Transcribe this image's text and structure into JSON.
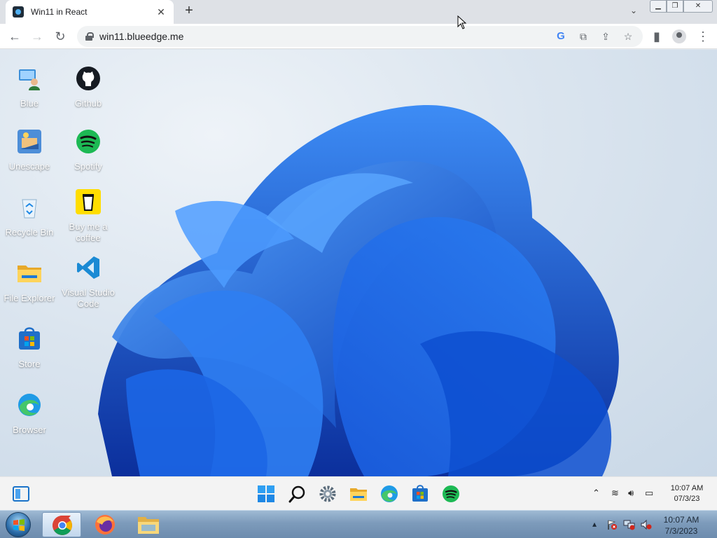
{
  "browser": {
    "tab_title": "Win11 in React",
    "tab_close": "✕",
    "new_tab": "+",
    "tab_search": "⌄",
    "window_controls": {
      "minimize": "▁",
      "maximize": "❐",
      "close": "✕"
    },
    "url": "win11.blueedge.me",
    "back": "←",
    "forward": "→",
    "reload": "↻",
    "google_icon": "G",
    "open_icon": "⧉",
    "share_icon": "⇪",
    "star_icon": "☆",
    "sidepanel_icon": "▮",
    "menu_icon": "⋮"
  },
  "desktop": {
    "icons": [
      {
        "label": "Blue"
      },
      {
        "label": "Github"
      },
      {
        "label": "Unescape"
      },
      {
        "label": "Spotify"
      },
      {
        "label": "Recycle Bin"
      },
      {
        "label": "Buy me a coffee"
      },
      {
        "label": "File Explorer"
      },
      {
        "label": "Visual Studio Code"
      },
      {
        "label": "Store"
      },
      {
        "label": "Browser"
      }
    ]
  },
  "win11_taskbar": {
    "time": "10:07 AM",
    "date": "07/3/23",
    "tray_chevron": "⌃",
    "wifi_icon": "≋",
    "sound_icon": "🔊︎",
    "battery_icon": "▭"
  },
  "win7_taskbar": {
    "time": "10:07 AM",
    "date": "7/3/2023",
    "tray_chevron": "▴"
  },
  "colors": {
    "accent_blue": "#1a73e8",
    "spotify_green": "#1db954",
    "bloom_blue": "#0a5fd9"
  }
}
